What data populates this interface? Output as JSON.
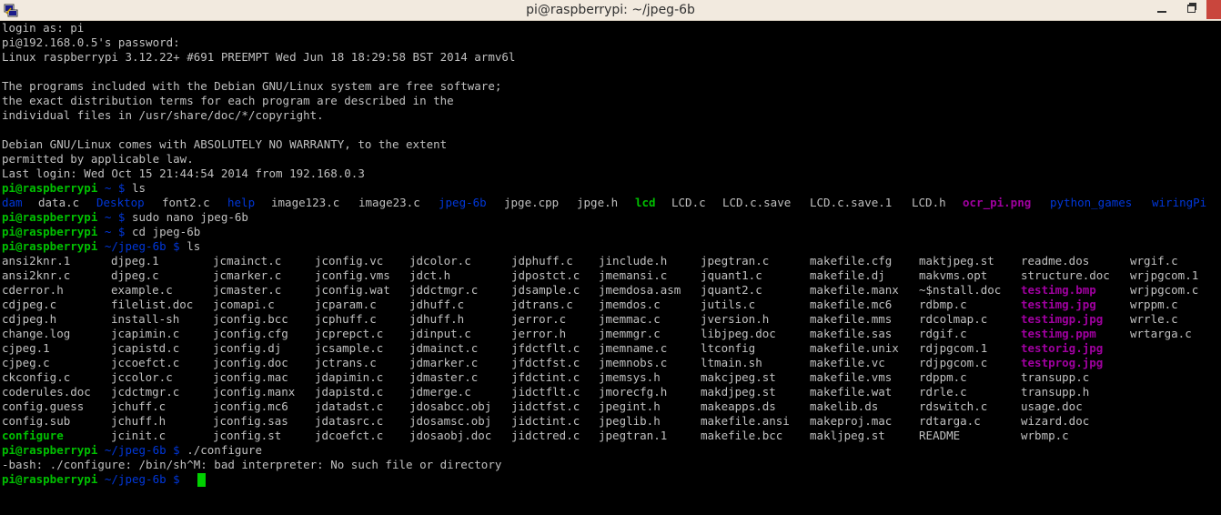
{
  "window": {
    "title": "pi@raspberrypi: ~/jpeg-6b",
    "controls": [
      "minimize",
      "maximize",
      "close"
    ]
  },
  "terminal": {
    "intro": [
      "login as: pi",
      "pi@192.168.0.5's password:",
      "Linux raspberrypi 3.12.22+ #691 PREEMPT Wed Jun 18 18:29:58 BST 2014 armv6l",
      "",
      "The programs included with the Debian GNU/Linux system are free software;",
      "the exact distribution terms for each program are described in the",
      "individual files in /usr/share/doc/*/copyright.",
      "",
      "Debian GNU/Linux comes with ABSOLUTELY NO WARRANTY, to the extent",
      "permitted by applicable law.",
      "Last login: Wed Oct 15 21:44:54 2014 from 192.168.0.3"
    ],
    "prompt_user": "pi@raspberrypi",
    "prompt_home": " ~ $ ",
    "prompt_jpeg": " ~/jpeg-6b $ ",
    "cmd_ls1": "ls",
    "home_listing": [
      {
        "name": "dam",
        "type": "dir"
      },
      {
        "name": "data.c",
        "type": "file"
      },
      {
        "name": "Desktop",
        "type": "dir"
      },
      {
        "name": "font2.c",
        "type": "file"
      },
      {
        "name": "help",
        "type": "dir"
      },
      {
        "name": "image123.c",
        "type": "file"
      },
      {
        "name": "image23.c",
        "type": "file"
      },
      {
        "name": "jpeg-6b",
        "type": "dir"
      },
      {
        "name": "jpge.cpp",
        "type": "file"
      },
      {
        "name": "jpge.h",
        "type": "file"
      },
      {
        "name": "lcd",
        "type": "exe"
      },
      {
        "name": "LCD.c",
        "type": "file"
      },
      {
        "name": "LCD.c.save",
        "type": "file"
      },
      {
        "name": "LCD.c.save.1",
        "type": "file"
      },
      {
        "name": "LCD.h",
        "type": "file"
      },
      {
        "name": "ocr_pi.png",
        "type": "img"
      },
      {
        "name": "python_games",
        "type": "dir"
      },
      {
        "name": "wiringPi",
        "type": "dir"
      }
    ],
    "cmd_nano": "sudo nano jpeg-6b",
    "cmd_cd": "cd jpeg-6b",
    "cmd_ls2": "ls",
    "jpeg_listing": [
      [
        {
          "name": "ansi2knr.1",
          "type": "file"
        },
        {
          "name": "djpeg.1",
          "type": "file"
        },
        {
          "name": "jcmainct.c",
          "type": "file"
        },
        {
          "name": "jconfig.vc",
          "type": "file"
        },
        {
          "name": "jdcolor.c",
          "type": "file"
        },
        {
          "name": "jdphuff.c",
          "type": "file"
        },
        {
          "name": "jinclude.h",
          "type": "file"
        },
        {
          "name": "jpegtran.c",
          "type": "file"
        },
        {
          "name": "makefile.cfg",
          "type": "file"
        },
        {
          "name": "maktjpeg.st",
          "type": "file"
        },
        {
          "name": "readme.dos",
          "type": "file"
        },
        {
          "name": "wrgif.c",
          "type": "file"
        }
      ],
      [
        {
          "name": "ansi2knr.c",
          "type": "file"
        },
        {
          "name": "djpeg.c",
          "type": "file"
        },
        {
          "name": "jcmarker.c",
          "type": "file"
        },
        {
          "name": "jconfig.vms",
          "type": "file"
        },
        {
          "name": "jdct.h",
          "type": "file"
        },
        {
          "name": "jdpostct.c",
          "type": "file"
        },
        {
          "name": "jmemansi.c",
          "type": "file"
        },
        {
          "name": "jquant1.c",
          "type": "file"
        },
        {
          "name": "makefile.dj",
          "type": "file"
        },
        {
          "name": "makvms.opt",
          "type": "file"
        },
        {
          "name": "structure.doc",
          "type": "file"
        },
        {
          "name": "wrjpgcom.1",
          "type": "file"
        }
      ],
      [
        {
          "name": "cderror.h",
          "type": "file"
        },
        {
          "name": "example.c",
          "type": "file"
        },
        {
          "name": "jcmaster.c",
          "type": "file"
        },
        {
          "name": "jconfig.wat",
          "type": "file"
        },
        {
          "name": "jddctmgr.c",
          "type": "file"
        },
        {
          "name": "jdsample.c",
          "type": "file"
        },
        {
          "name": "jmemdosa.asm",
          "type": "file"
        },
        {
          "name": "jquant2.c",
          "type": "file"
        },
        {
          "name": "makefile.manx",
          "type": "file"
        },
        {
          "name": "~$nstall.doc",
          "type": "file"
        },
        {
          "name": "testimg.bmp",
          "type": "img"
        },
        {
          "name": "wrjpgcom.c",
          "type": "file"
        }
      ],
      [
        {
          "name": "cdjpeg.c",
          "type": "file"
        },
        {
          "name": "filelist.doc",
          "type": "file"
        },
        {
          "name": "jcomapi.c",
          "type": "file"
        },
        {
          "name": "jcparam.c",
          "type": "file"
        },
        {
          "name": "jdhuff.c",
          "type": "file"
        },
        {
          "name": "jdtrans.c",
          "type": "file"
        },
        {
          "name": "jmemdos.c",
          "type": "file"
        },
        {
          "name": "jutils.c",
          "type": "file"
        },
        {
          "name": "makefile.mc6",
          "type": "file"
        },
        {
          "name": "rdbmp.c",
          "type": "file"
        },
        {
          "name": "testimg.jpg",
          "type": "img"
        },
        {
          "name": "wrppm.c",
          "type": "file"
        }
      ],
      [
        {
          "name": "cdjpeg.h",
          "type": "file"
        },
        {
          "name": "install-sh",
          "type": "file"
        },
        {
          "name": "jconfig.bcc",
          "type": "file"
        },
        {
          "name": "jcphuff.c",
          "type": "file"
        },
        {
          "name": "jdhuff.h",
          "type": "file"
        },
        {
          "name": "jerror.c",
          "type": "file"
        },
        {
          "name": "jmemmac.c",
          "type": "file"
        },
        {
          "name": "jversion.h",
          "type": "file"
        },
        {
          "name": "makefile.mms",
          "type": "file"
        },
        {
          "name": "rdcolmap.c",
          "type": "file"
        },
        {
          "name": "testimgp.jpg",
          "type": "img"
        },
        {
          "name": "wrrle.c",
          "type": "file"
        }
      ],
      [
        {
          "name": "change.log",
          "type": "file"
        },
        {
          "name": "jcapimin.c",
          "type": "file"
        },
        {
          "name": "jconfig.cfg",
          "type": "file"
        },
        {
          "name": "jcprepct.c",
          "type": "file"
        },
        {
          "name": "jdinput.c",
          "type": "file"
        },
        {
          "name": "jerror.h",
          "type": "file"
        },
        {
          "name": "jmemmgr.c",
          "type": "file"
        },
        {
          "name": "libjpeg.doc",
          "type": "file"
        },
        {
          "name": "makefile.sas",
          "type": "file"
        },
        {
          "name": "rdgif.c",
          "type": "file"
        },
        {
          "name": "testimg.ppm",
          "type": "img"
        },
        {
          "name": "wrtarga.c",
          "type": "file"
        }
      ],
      [
        {
          "name": "cjpeg.1",
          "type": "file"
        },
        {
          "name": "jcapistd.c",
          "type": "file"
        },
        {
          "name": "jconfig.dj",
          "type": "file"
        },
        {
          "name": "jcsample.c",
          "type": "file"
        },
        {
          "name": "jdmainct.c",
          "type": "file"
        },
        {
          "name": "jfdctflt.c",
          "type": "file"
        },
        {
          "name": "jmemname.c",
          "type": "file"
        },
        {
          "name": "ltconfig",
          "type": "file"
        },
        {
          "name": "makefile.unix",
          "type": "file"
        },
        {
          "name": "rdjpgcom.1",
          "type": "file"
        },
        {
          "name": "testorig.jpg",
          "type": "img"
        }
      ],
      [
        {
          "name": "cjpeg.c",
          "type": "file"
        },
        {
          "name": "jccoefct.c",
          "type": "file"
        },
        {
          "name": "jconfig.doc",
          "type": "file"
        },
        {
          "name": "jctrans.c",
          "type": "file"
        },
        {
          "name": "jdmarker.c",
          "type": "file"
        },
        {
          "name": "jfdctfst.c",
          "type": "file"
        },
        {
          "name": "jmemnobs.c",
          "type": "file"
        },
        {
          "name": "ltmain.sh",
          "type": "file"
        },
        {
          "name": "makefile.vc",
          "type": "file"
        },
        {
          "name": "rdjpgcom.c",
          "type": "file"
        },
        {
          "name": "testprog.jpg",
          "type": "img"
        }
      ],
      [
        {
          "name": "ckconfig.c",
          "type": "file"
        },
        {
          "name": "jccolor.c",
          "type": "file"
        },
        {
          "name": "jconfig.mac",
          "type": "file"
        },
        {
          "name": "jdapimin.c",
          "type": "file"
        },
        {
          "name": "jdmaster.c",
          "type": "file"
        },
        {
          "name": "jfdctint.c",
          "type": "file"
        },
        {
          "name": "jmemsys.h",
          "type": "file"
        },
        {
          "name": "makcjpeg.st",
          "type": "file"
        },
        {
          "name": "makefile.vms",
          "type": "file"
        },
        {
          "name": "rdppm.c",
          "type": "file"
        },
        {
          "name": "transupp.c",
          "type": "file"
        }
      ],
      [
        {
          "name": "coderules.doc",
          "type": "file"
        },
        {
          "name": "jcdctmgr.c",
          "type": "file"
        },
        {
          "name": "jconfig.manx",
          "type": "file"
        },
        {
          "name": "jdapistd.c",
          "type": "file"
        },
        {
          "name": "jdmerge.c",
          "type": "file"
        },
        {
          "name": "jidctflt.c",
          "type": "file"
        },
        {
          "name": "jmorecfg.h",
          "type": "file"
        },
        {
          "name": "makdjpeg.st",
          "type": "file"
        },
        {
          "name": "makefile.wat",
          "type": "file"
        },
        {
          "name": "rdrle.c",
          "type": "file"
        },
        {
          "name": "transupp.h",
          "type": "file"
        }
      ],
      [
        {
          "name": "config.guess",
          "type": "file"
        },
        {
          "name": "jchuff.c",
          "type": "file"
        },
        {
          "name": "jconfig.mc6",
          "type": "file"
        },
        {
          "name": "jdatadst.c",
          "type": "file"
        },
        {
          "name": "jdosabcc.obj",
          "type": "file"
        },
        {
          "name": "jidctfst.c",
          "type": "file"
        },
        {
          "name": "jpegint.h",
          "type": "file"
        },
        {
          "name": "makeapps.ds",
          "type": "file"
        },
        {
          "name": "makelib.ds",
          "type": "file"
        },
        {
          "name": "rdswitch.c",
          "type": "file"
        },
        {
          "name": "usage.doc",
          "type": "file"
        }
      ],
      [
        {
          "name": "config.sub",
          "type": "file"
        },
        {
          "name": "jchuff.h",
          "type": "file"
        },
        {
          "name": "jconfig.sas",
          "type": "file"
        },
        {
          "name": "jdatasrc.c",
          "type": "file"
        },
        {
          "name": "jdosamsc.obj",
          "type": "file"
        },
        {
          "name": "jidctint.c",
          "type": "file"
        },
        {
          "name": "jpeglib.h",
          "type": "file"
        },
        {
          "name": "makefile.ansi",
          "type": "file"
        },
        {
          "name": "makeproj.mac",
          "type": "file"
        },
        {
          "name": "rdtarga.c",
          "type": "file"
        },
        {
          "name": "wizard.doc",
          "type": "file"
        }
      ],
      [
        {
          "name": "configure",
          "type": "exe"
        },
        {
          "name": "jcinit.c",
          "type": "file"
        },
        {
          "name": "jconfig.st",
          "type": "file"
        },
        {
          "name": "jdcoefct.c",
          "type": "file"
        },
        {
          "name": "jdosaobj.doc",
          "type": "file"
        },
        {
          "name": "jidctred.c",
          "type": "file"
        },
        {
          "name": "jpegtran.1",
          "type": "file"
        },
        {
          "name": "makefile.bcc",
          "type": "file"
        },
        {
          "name": "makljpeg.st",
          "type": "file"
        },
        {
          "name": "README",
          "type": "file"
        },
        {
          "name": "wrbmp.c",
          "type": "file"
        }
      ]
    ],
    "cmd_configure": "./configure",
    "error_line": "-bash: ./configure: /bin/sh^M: bad interpreter: No such file or directory",
    "colors": {
      "background": "#000000",
      "text": "#c0c0c0",
      "prompt_user": "#00c000",
      "directory": "#0037da",
      "executable": "#00c000",
      "image": "#a000a0",
      "cursor": "#00d000"
    }
  }
}
